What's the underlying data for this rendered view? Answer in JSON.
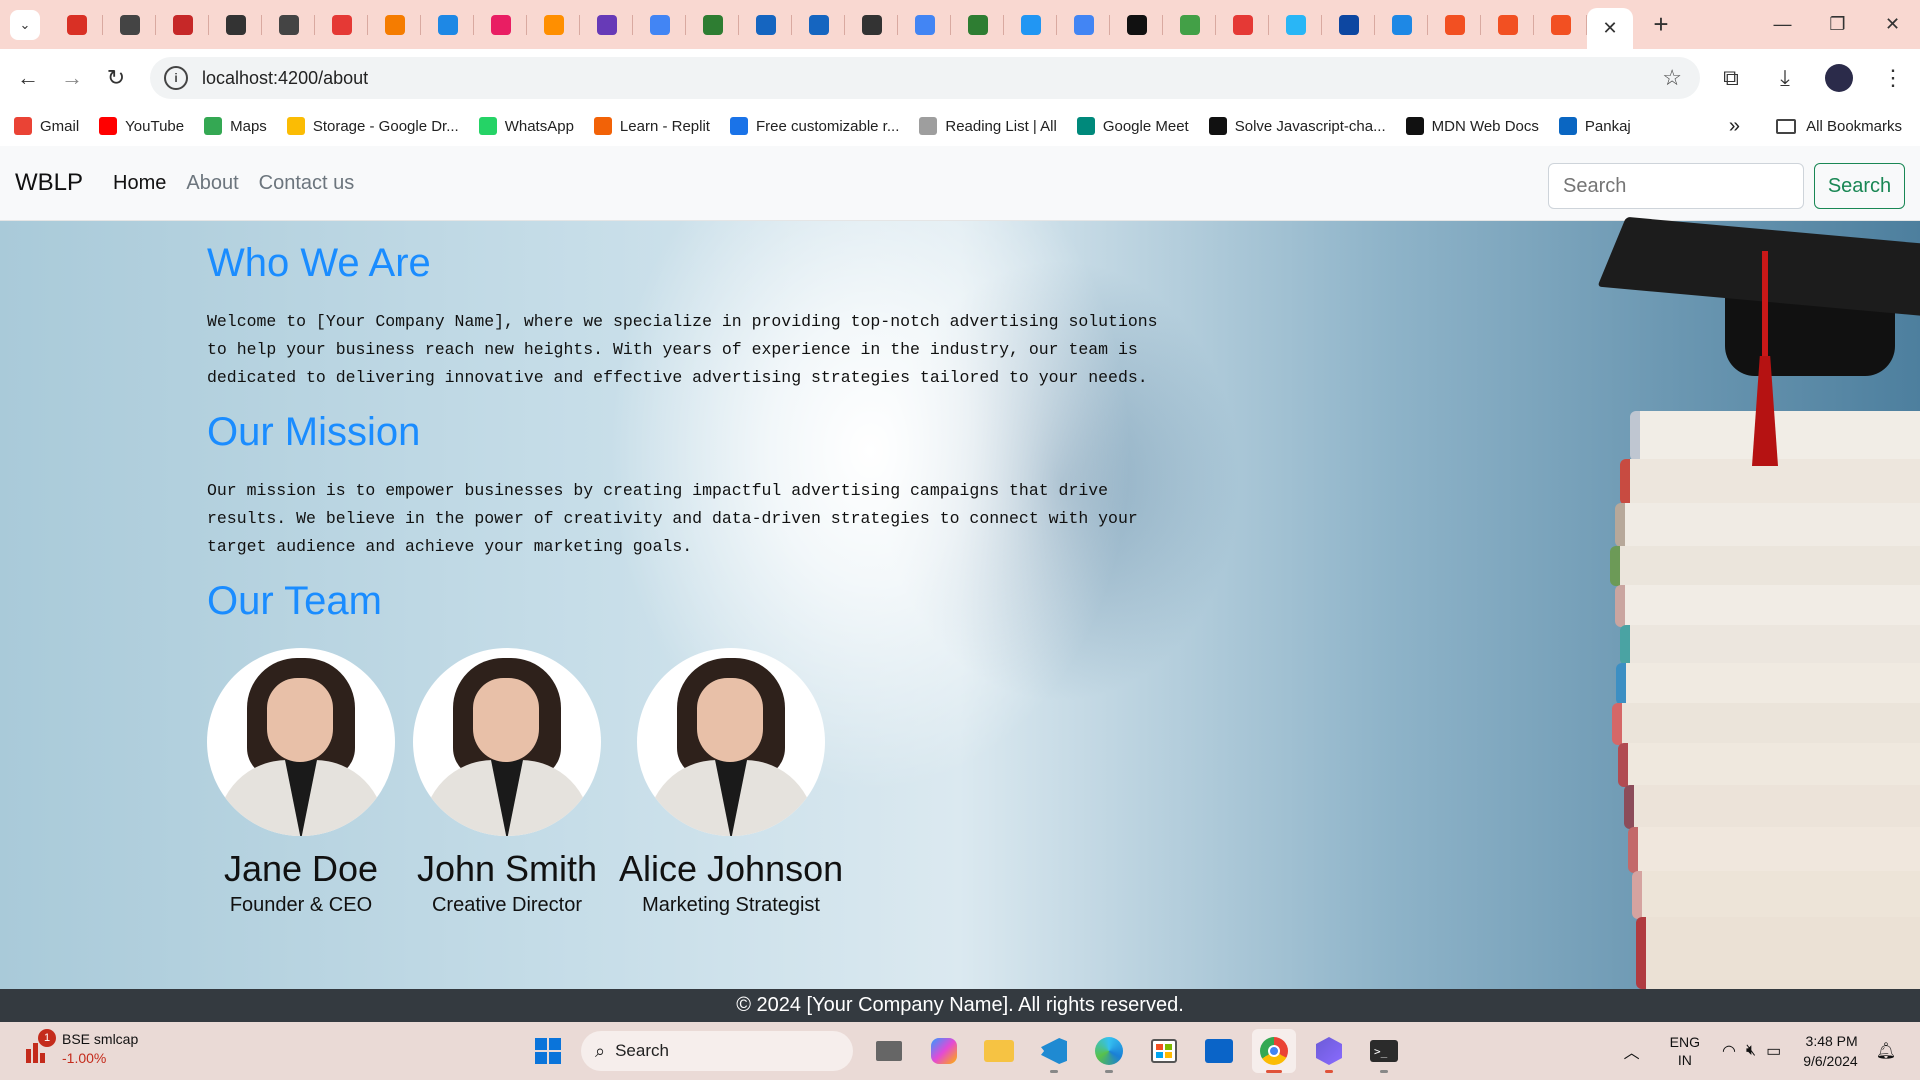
{
  "browser": {
    "url": "localhost:4200/about",
    "bookmarks": [
      {
        "label": "Gmail",
        "color": "#ea4335"
      },
      {
        "label": "YouTube",
        "color": "#ff0000"
      },
      {
        "label": "Maps",
        "color": "#34a853"
      },
      {
        "label": "Storage - Google Dr...",
        "color": "#fbbc04"
      },
      {
        "label": "WhatsApp",
        "color": "#25d366"
      },
      {
        "label": "Learn - Replit",
        "color": "#f26207"
      },
      {
        "label": "Free customizable r...",
        "color": "#1a73e8"
      },
      {
        "label": "Reading List | All",
        "color": "#9e9e9e"
      },
      {
        "label": "Google Meet",
        "color": "#00897b"
      },
      {
        "label": "Solve Javascript-cha...",
        "color": "#111111"
      },
      {
        "label": "MDN Web Docs",
        "color": "#111111"
      },
      {
        "label": "Pankaj",
        "color": "#0a66c2"
      }
    ],
    "all_bookmarks": "All Bookmarks",
    "pinned_tabs": [
      "#d93025",
      "#444444",
      "#c62828",
      "#333333",
      "#444444",
      "#e53935",
      "#f57c00",
      "#1e88e5",
      "#e91e63",
      "#ff8f00",
      "#673ab7",
      "#4285f4",
      "#2e7d32",
      "#1565c0",
      "#1565c0",
      "#333333",
      "#4285f4",
      "#2e7d32",
      "#2196f3",
      "#4285f4",
      "#111111",
      "#43a047",
      "#e53935",
      "#29b6f6",
      "#0d47a1",
      "#1e88e5",
      "#f25022",
      "#f25022",
      "#f25022"
    ]
  },
  "site": {
    "brand": "WBLP",
    "nav": [
      "Home",
      "About",
      "Contact us"
    ],
    "search_placeholder": "Search",
    "search_button": "Search",
    "sections": [
      {
        "title": "Who We Are",
        "body": "Welcome to [Your Company Name], where we specialize in providing top-notch advertising solutions to help your business reach new heights. With years of experience in the industry, our team is dedicated to delivering innovative and effective advertising strategies tailored to your needs."
      },
      {
        "title": "Our Mission",
        "body": "Our mission is to empower businesses by creating impactful advertising campaigns that drive results. We believe in the power of creativity and data-driven strategies to connect with your target audience and achieve your marketing goals."
      }
    ],
    "team_title": "Our Team",
    "team": [
      {
        "name": "Jane Doe",
        "role": "Founder & CEO"
      },
      {
        "name": "John Smith",
        "role": "Creative Director"
      },
      {
        "name": "Alice Johnson",
        "role": "Marketing Strategist"
      }
    ],
    "footer": "© 2024 [Your Company Name]. All rights reserved."
  },
  "taskbar": {
    "widget_badge": "1",
    "widget_name": "BSE smlcap",
    "widget_change": "-1.00%",
    "search": "Search",
    "lang_1": "ENG",
    "lang_2": "IN",
    "time": "3:48 PM",
    "date": "9/6/2024"
  }
}
